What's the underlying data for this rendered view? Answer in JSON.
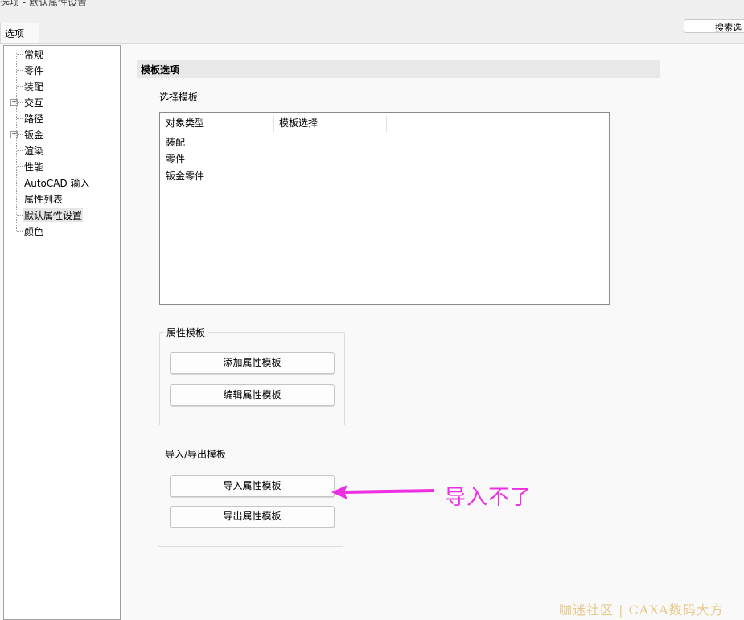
{
  "window": {
    "title": "选项 - 默认属性设置"
  },
  "tabs": [
    {
      "label": "选项"
    }
  ],
  "search": {
    "label": "搜索选"
  },
  "tree": {
    "items": [
      {
        "label": "常规",
        "expandable": false
      },
      {
        "label": "零件",
        "expandable": false
      },
      {
        "label": "装配",
        "expandable": false
      },
      {
        "label": "交互",
        "expandable": true
      },
      {
        "label": "路径",
        "expandable": false
      },
      {
        "label": "钣金",
        "expandable": true
      },
      {
        "label": "渲染",
        "expandable": false
      },
      {
        "label": "性能",
        "expandable": false
      },
      {
        "label": "AutoCAD 输入",
        "expandable": false
      },
      {
        "label": "属性列表",
        "expandable": false
      },
      {
        "label": "默认属性设置",
        "expandable": false,
        "selected": true
      },
      {
        "label": "颜色",
        "expandable": false
      }
    ],
    "expander_glyph": "+"
  },
  "content": {
    "section_title": "模板选项",
    "select_template_label": "选择模板",
    "template_list": {
      "columns": [
        "对象类型",
        "模板选择"
      ],
      "rows": [
        "装配",
        "零件",
        "钣金零件"
      ]
    },
    "attribute_template_group": {
      "title": "属性模板",
      "add_button": "添加属性模板",
      "edit_button": "编辑属性模板"
    },
    "import_export_group": {
      "title": "导入/导出模板",
      "import_button": "导入属性模板",
      "export_button": "导出属性模板"
    }
  },
  "annotation": {
    "text": "导入不了",
    "color": "#ee2ee2"
  },
  "watermark": {
    "text": "咖迷社区 | CAXA数码大方"
  }
}
